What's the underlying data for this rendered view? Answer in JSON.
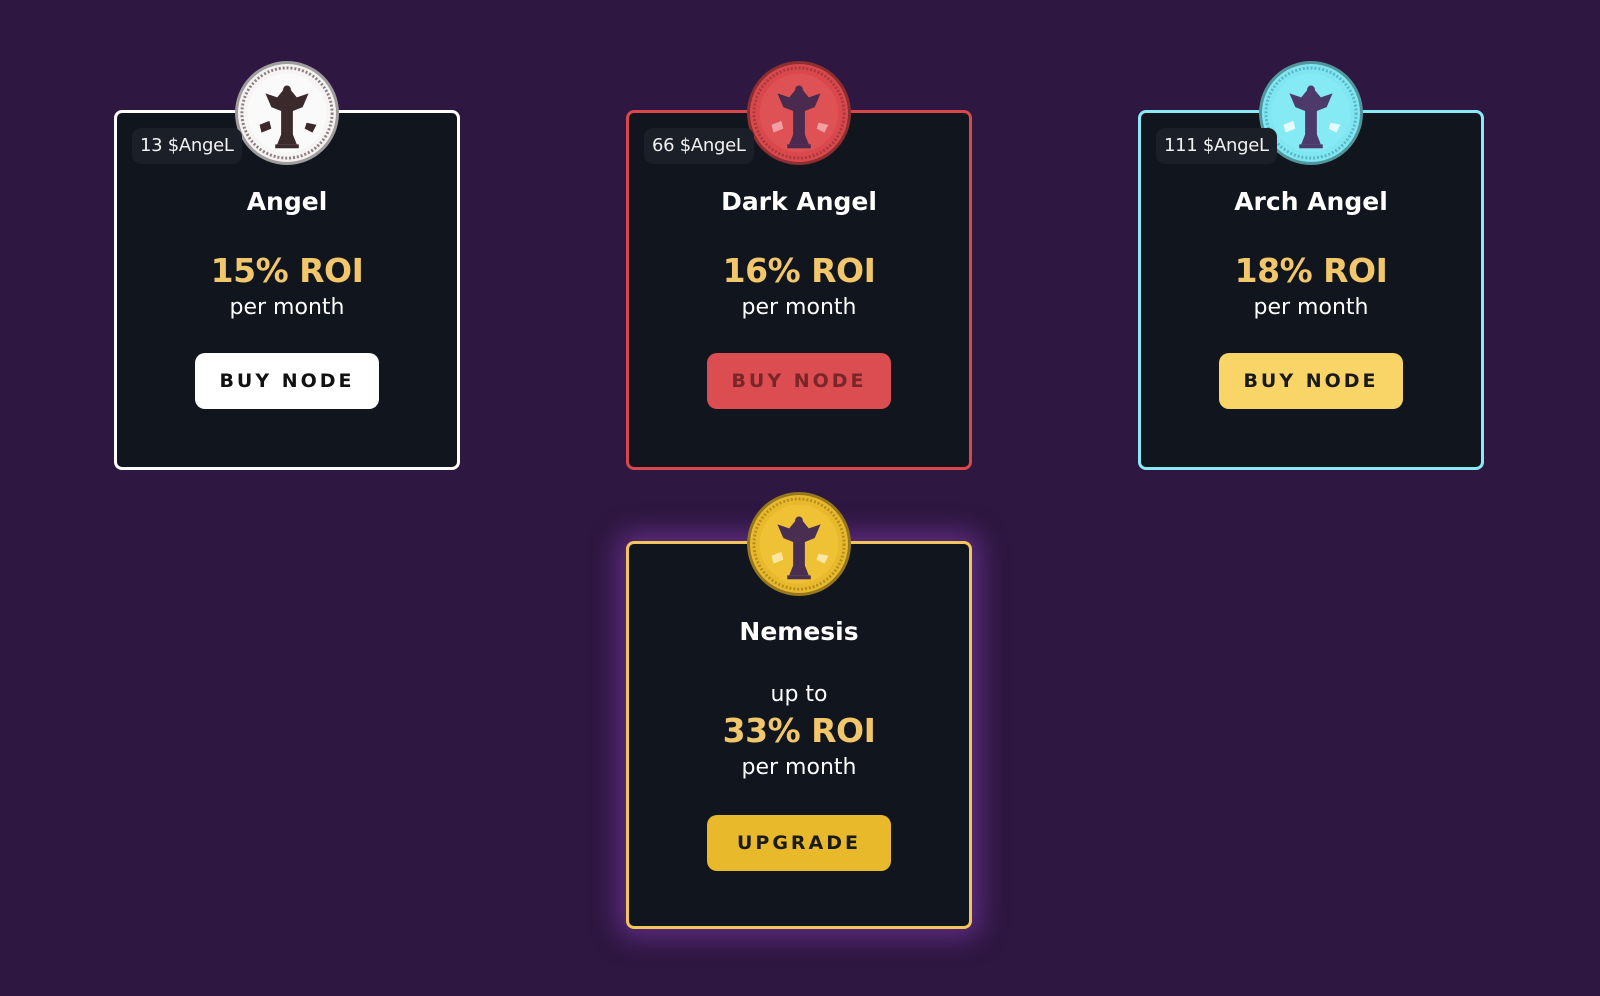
{
  "colors": {
    "background": "#2e1741",
    "card_bg": "#11151d",
    "roi_text": "#f2c66b"
  },
  "cards": [
    {
      "id": "angel",
      "price": "13 $AngeL",
      "title": "Angel",
      "roi": "15% ROI",
      "period": "per month",
      "button": "BUY NODE",
      "accent": "#ffffff",
      "coin_icon": "angel-coin-icon"
    },
    {
      "id": "dark-angel",
      "price": "66 $AngeL",
      "title": "Dark Angel",
      "roi": "16% ROI",
      "period": "per month",
      "button": "BUY NODE",
      "accent": "#d7474b",
      "coin_icon": "dark-angel-coin-icon"
    },
    {
      "id": "arch-angel",
      "price": "111 $AngeL",
      "title": "Arch Angel",
      "roi": "18% ROI",
      "period": "per month",
      "button": "BUY NODE",
      "accent": "#8be9f5",
      "coin_icon": "arch-angel-coin-icon"
    },
    {
      "id": "nemesis",
      "title": "Nemesis",
      "prefix": "up to",
      "roi": "33% ROI",
      "period": "per month",
      "button": "UPGRADE",
      "accent": "#f2c55a",
      "coin_icon": "nemesis-coin-icon"
    }
  ]
}
